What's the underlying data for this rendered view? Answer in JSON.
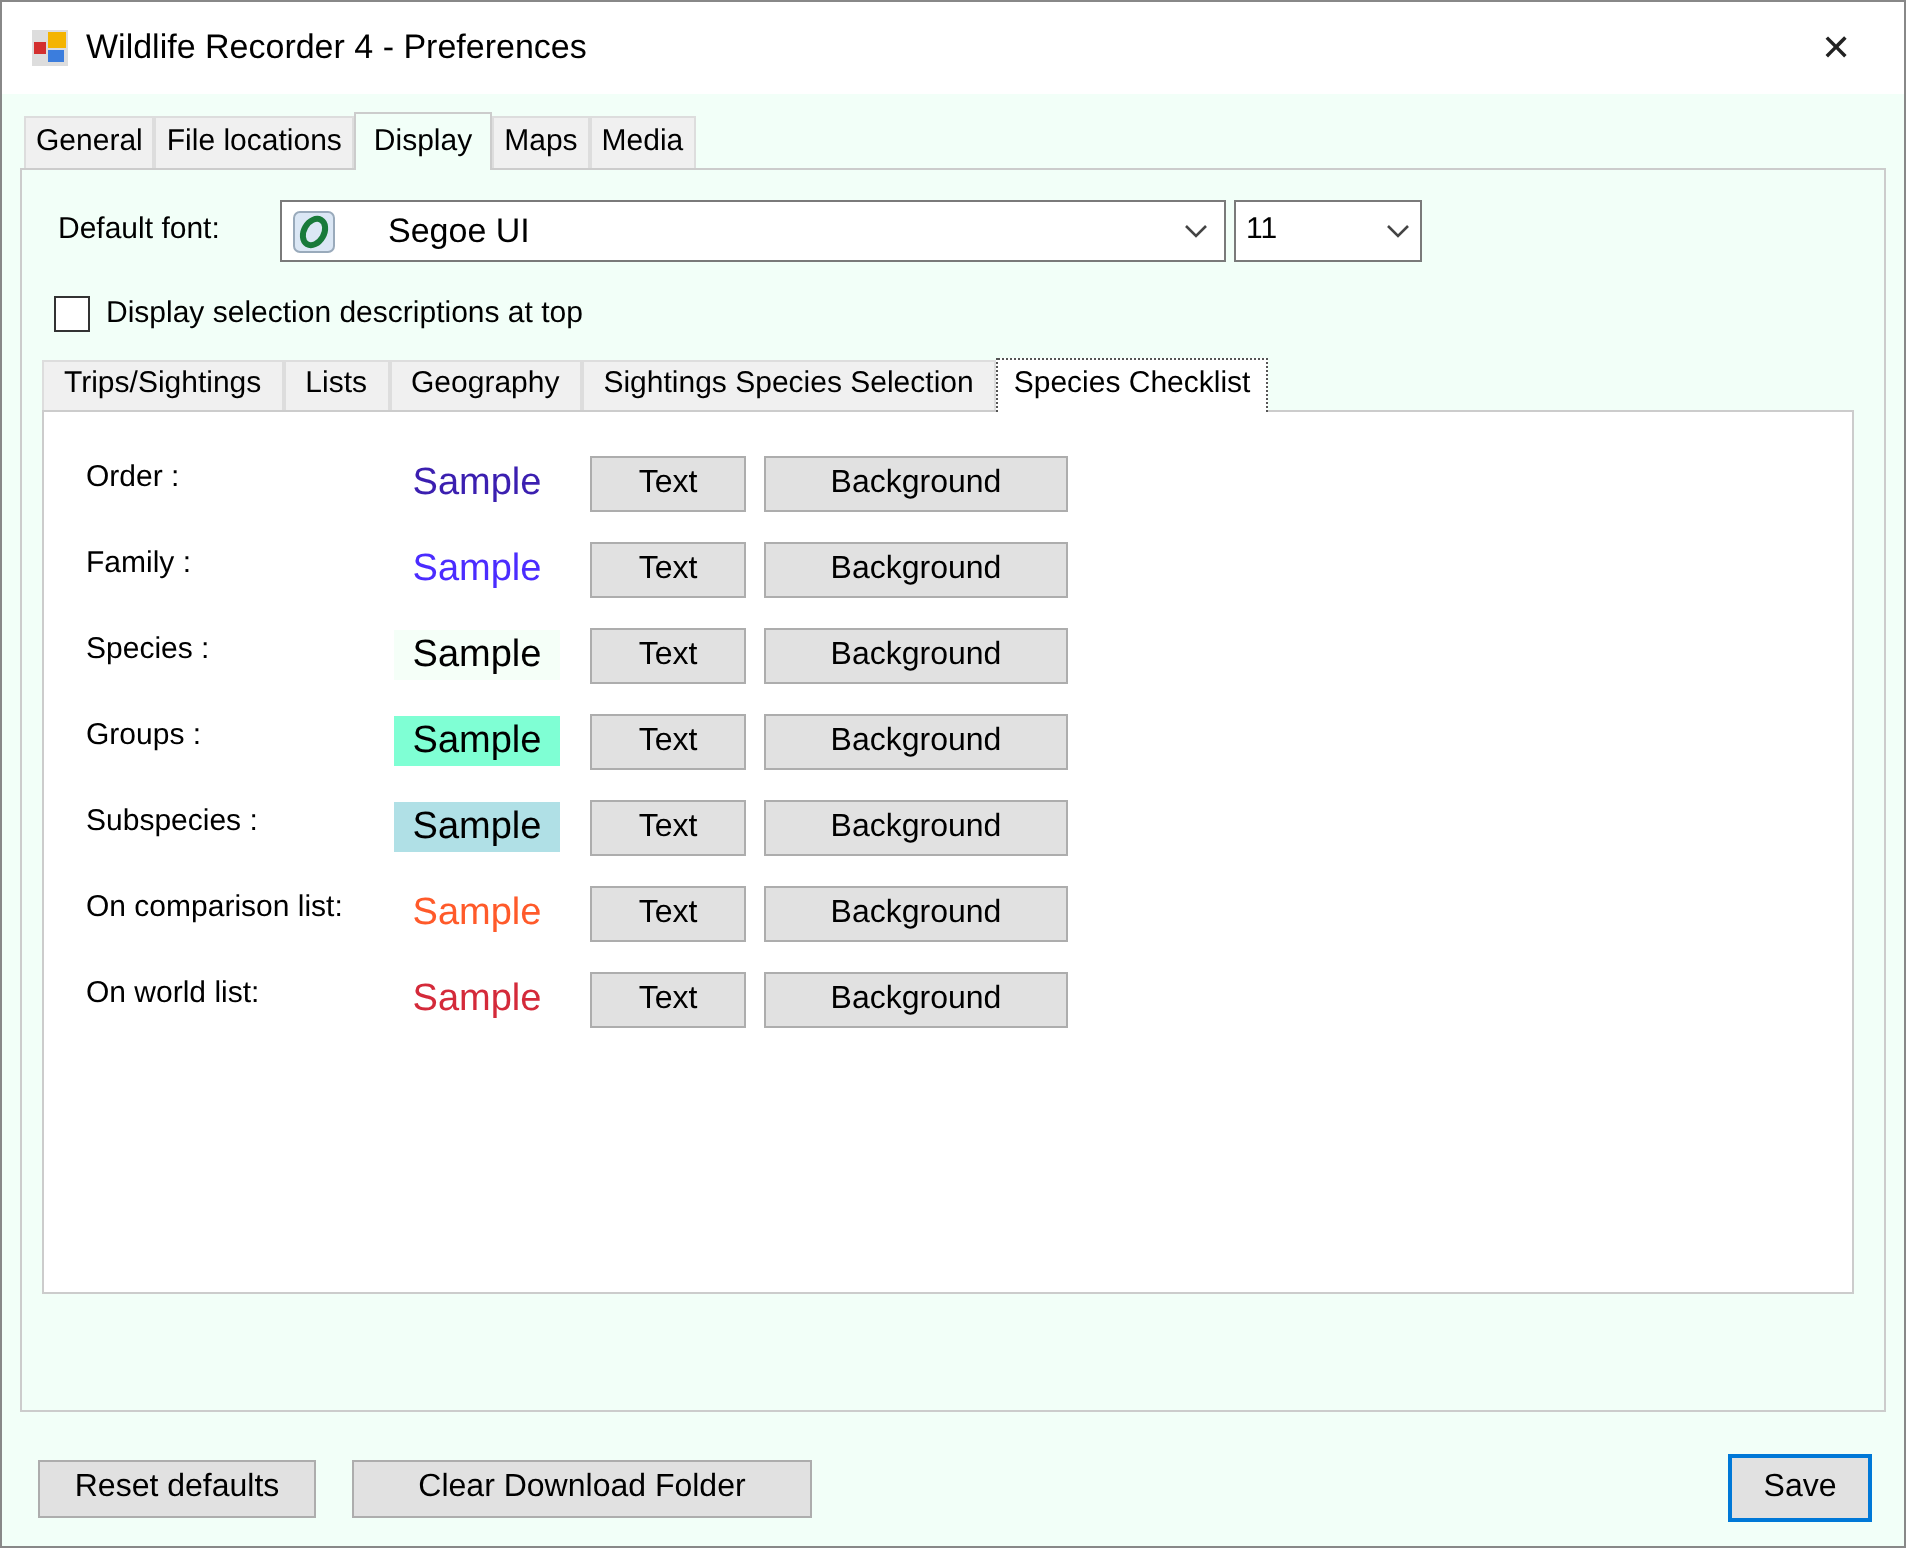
{
  "window": {
    "title": "Wildlife Recorder 4 - Preferences",
    "close": "✕"
  },
  "tabs": [
    {
      "label": "General",
      "selected": false
    },
    {
      "label": "File locations",
      "selected": false
    },
    {
      "label": "Display",
      "selected": true
    },
    {
      "label": "Maps",
      "selected": false
    },
    {
      "label": "Media",
      "selected": false
    }
  ],
  "default_font": {
    "label": "Default font:",
    "value": "Segoe UI",
    "size": "11"
  },
  "display_descriptions": {
    "label": "Display selection descriptions at top",
    "checked": false
  },
  "inner_tabs": [
    {
      "label": "Trips/Sightings",
      "selected": false
    },
    {
      "label": "Lists",
      "selected": false
    },
    {
      "label": "Geography",
      "selected": false
    },
    {
      "label": "Sightings Species Selection",
      "selected": false
    },
    {
      "label": "Species Checklist",
      "selected": true
    }
  ],
  "styles": [
    {
      "label": "Order :",
      "sample": "Sample",
      "color": "#3b1fb0",
      "text_button": "Text",
      "background_button": "Background"
    },
    {
      "label": "Family :",
      "sample": "Sample",
      "color": "#4b2cff",
      "text_button": "Text",
      "background_button": "Background"
    },
    {
      "label": "Species :",
      "sample": "Sample",
      "color": "#000000",
      "highlight": {
        "color": "#f5fff8"
      },
      "text_button": "Text",
      "background_button": "Background"
    },
    {
      "label": "Groups :",
      "sample": "Sample",
      "color": "#000000",
      "highlight": {
        "color": "#7fffd4"
      },
      "text_button": "Text",
      "background_button": "Background"
    },
    {
      "label": "Subspecies :",
      "sample": "Sample",
      "color": "#000000",
      "highlight": {
        "color": "#b0e0e6"
      },
      "text_button": "Text",
      "background_button": "Background"
    },
    {
      "label": "On comparison list:",
      "sample": "Sample",
      "color": "#ff5a2a",
      "text_button": "Text",
      "background_button": "Background"
    },
    {
      "label": "On world list:",
      "sample": "Sample",
      "color": "#d42a3a",
      "text_button": "Text",
      "background_button": "Background"
    }
  ],
  "buttons": [
    {
      "label": "Reset defaults",
      "default": false
    },
    {
      "label": "Clear Download Folder",
      "default": false
    },
    {
      "label": "Save",
      "default": true
    }
  ]
}
